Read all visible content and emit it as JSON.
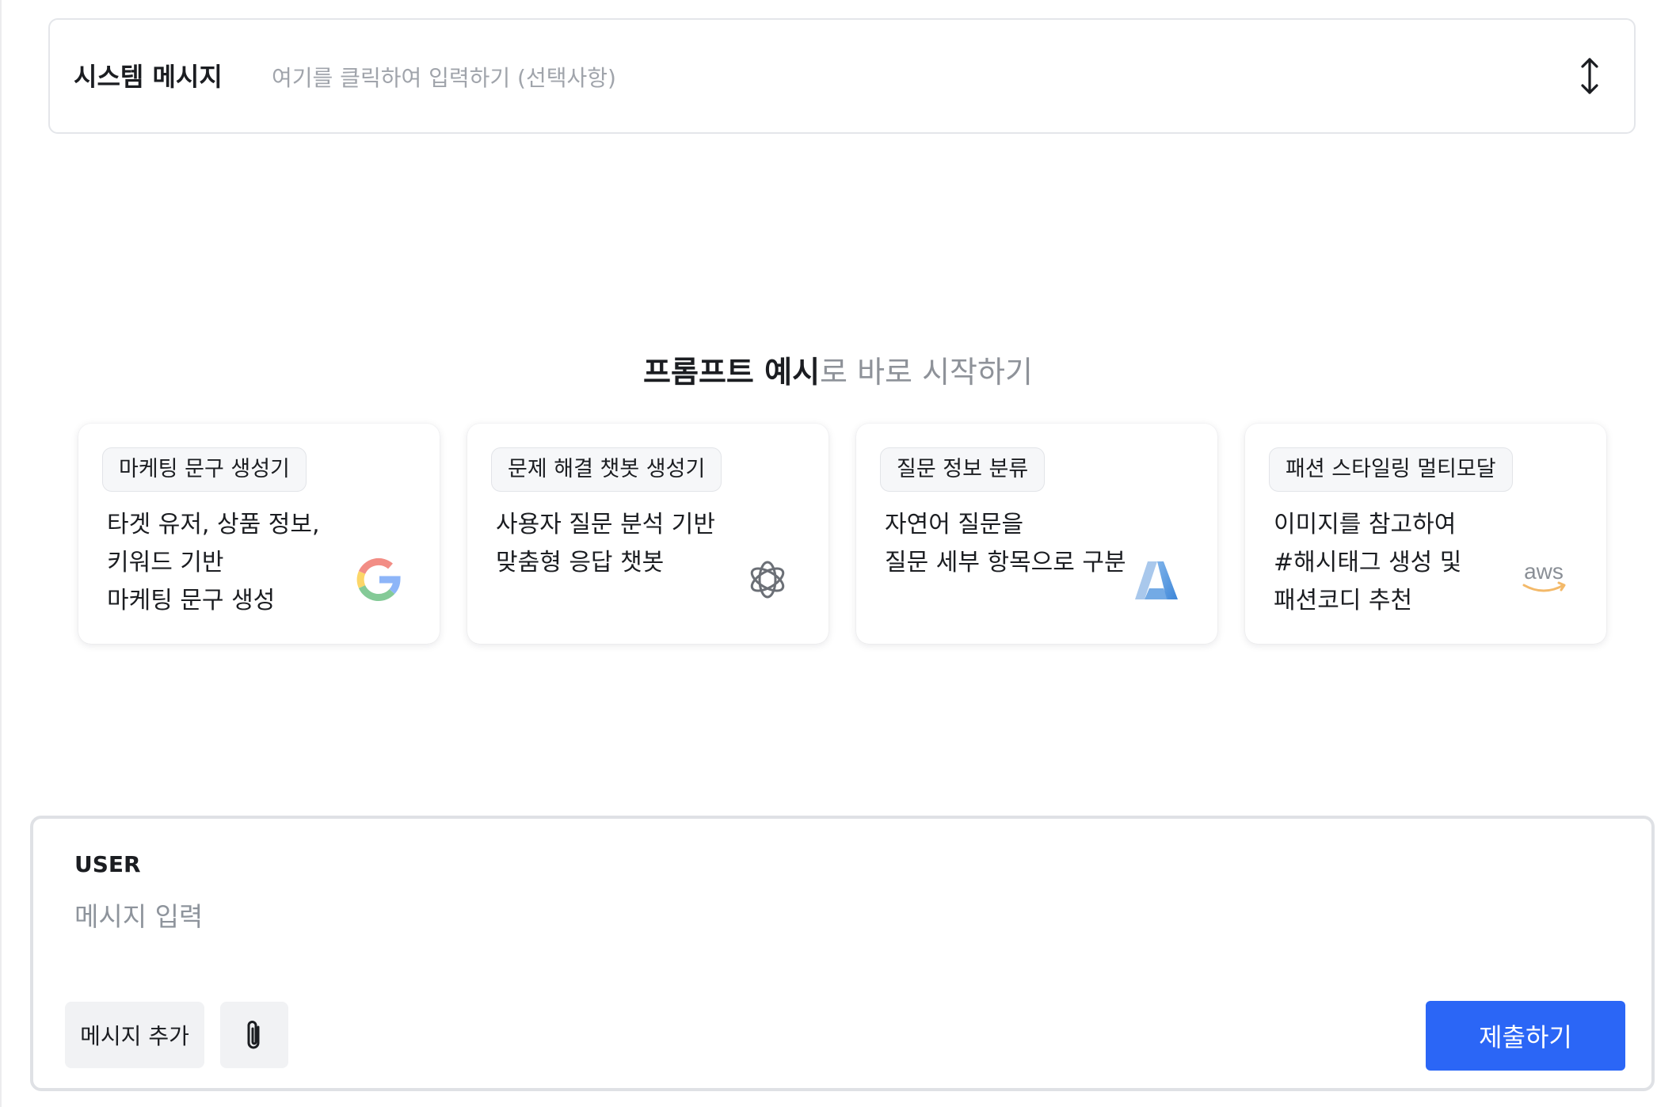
{
  "system_message": {
    "label": "시스템 메시지",
    "placeholder": "여기를 클릭하여 입력하기 (선택사항)",
    "expand_icon": "vertical-resize-arrows-icon"
  },
  "examples": {
    "heading_strong": "프롬프트 예시",
    "heading_light": "로 바로 시작하기",
    "cards": [
      {
        "tag": "마케팅 문구 생성기",
        "description": "타겟 유저, 상품 정보,\n키워드 기반\n마케팅 문구 생성",
        "logo": "google-logo-icon"
      },
      {
        "tag": "문제 해결 챗봇 생성기",
        "description": "사용자 질문 분석 기반\n맞춤형 응답 챗봇",
        "logo": "openai-logo-icon"
      },
      {
        "tag": "질문 정보 분류",
        "description": "자연어 질문을\n질문 세부 항목으로 구분",
        "logo": "azure-logo-icon"
      },
      {
        "tag": "패션 스타일링 멀티모달",
        "description": "이미지를 참고하여\n#해시태그 생성 및\n패션코디 추천",
        "logo": "aws-logo-icon",
        "logo_text": "aws"
      }
    ]
  },
  "composer": {
    "role": "USER",
    "input_placeholder": "메시지 입력",
    "input_value": "",
    "add_message_label": "메시지 추가",
    "attach_icon": "paperclip-icon",
    "submit_label": "제출하기",
    "submit_color": "#2b66f6"
  }
}
